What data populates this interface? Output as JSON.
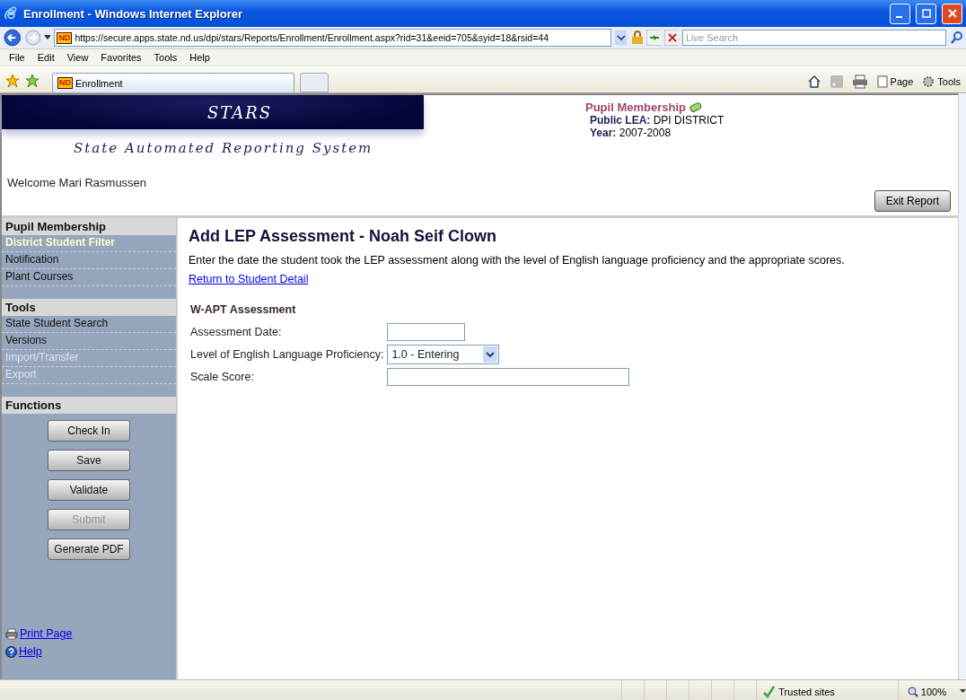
{
  "window": {
    "title": "Enrollment - Windows Internet Explorer"
  },
  "address_bar": {
    "badge": "ND",
    "url": "https://secure.apps.state.nd.us/dpi/stars/Reports/Enrollment/Enrollment.aspx?rid=31&eeid=705&syid=18&rsid=44"
  },
  "search": {
    "placeholder": "Live Search"
  },
  "menu": [
    "File",
    "Edit",
    "View",
    "Favorites",
    "Tools",
    "Help"
  ],
  "tab": {
    "badge": "ND",
    "label": "Enrollment"
  },
  "command_bar": [
    "Page",
    "Tools"
  ],
  "header": {
    "logo_title": "STARS",
    "logo_subtitle": "State Automated Reporting System",
    "welcome": "Welcome Mari Rasmussen",
    "module": "Pupil Membership",
    "lea_label": "Public LEA:",
    "lea_value": "DPI DISTRICT",
    "year_label": "Year:",
    "year_value": "2007-2008",
    "exit_button": "Exit Report"
  },
  "sidebar": {
    "sections": [
      {
        "title": "Pupil Membership",
        "kind": "links",
        "items": [
          {
            "label": "District Student Filter",
            "selected": true,
            "disabled": false
          },
          {
            "label": "Notification",
            "selected": false,
            "disabled": false
          },
          {
            "label": "Plant Courses",
            "selected": false,
            "disabled": false
          }
        ]
      },
      {
        "title": "Tools",
        "kind": "links",
        "items": [
          {
            "label": "State Student Search",
            "selected": false,
            "disabled": false
          },
          {
            "label": "Versions",
            "selected": false,
            "disabled": false
          },
          {
            "label": "Import/Transfer",
            "selected": false,
            "disabled": true
          },
          {
            "label": "Export",
            "selected": false,
            "disabled": true
          }
        ]
      },
      {
        "title": "Functions",
        "kind": "buttons",
        "items": [
          {
            "label": "Check In",
            "disabled": false
          },
          {
            "label": "Save",
            "disabled": false
          },
          {
            "label": "Validate",
            "disabled": false
          },
          {
            "label": "Submit",
            "disabled": true
          },
          {
            "label": "Generate PDF",
            "disabled": false
          }
        ]
      }
    ],
    "footer_links": [
      {
        "kind": "print",
        "label": "Print Page"
      },
      {
        "kind": "help",
        "label": "Help"
      }
    ]
  },
  "content": {
    "title": "Add LEP Assessment - Noah Seif Clown",
    "instructions": "Enter the date the student took the LEP assessment along with the level of English language proficiency and the appropriate scores.",
    "return_link": "Return to Student Detail",
    "form": {
      "title": "W-APT Assessment",
      "fields": [
        {
          "kind": "date",
          "label": "Assessment Date:"
        },
        {
          "kind": "select",
          "label": "Level of English Language Proficiency:",
          "value": "1.0 - Entering"
        },
        {
          "kind": "text",
          "label": "Scale Score:"
        }
      ]
    }
  },
  "status_bar": {
    "zone": "Trusted sites",
    "zoom": "100%"
  }
}
